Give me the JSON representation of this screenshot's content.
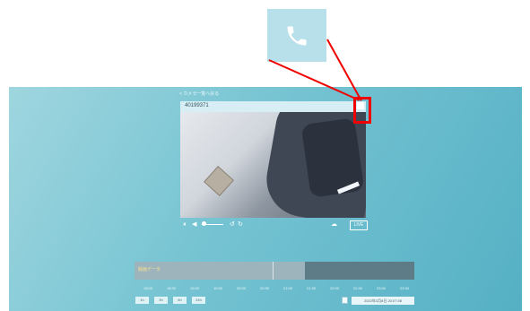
{
  "header": {
    "back_label": "< カメラ一覧へ戻る",
    "camera_id": "40199371"
  },
  "icons": {
    "phone": "phone-icon",
    "phone_small": "phone-icon",
    "back": "back-arrow-icon",
    "pause": "pause-icon",
    "prev": "prev-icon",
    "rotate": "rotate-icon",
    "cloud": "cloud-icon",
    "calendar": "calendar-icon"
  },
  "controls": {
    "pause": "⏸",
    "prev": "◀",
    "rotate_left": "↺",
    "rotate_right": "↻",
    "cloud": "☁",
    "rec": "LIVE"
  },
  "timeline": {
    "label": "録画データ",
    "ticks": [
      "18:00",
      "18:30",
      "19:00",
      "19:30",
      "20:00",
      "20:30",
      "21:00",
      "21:30",
      "22:00",
      "22:30",
      "23:00",
      "23:30"
    ]
  },
  "zoom_buttons": [
    "1h",
    "3h",
    "6h",
    "24h"
  ],
  "datetime": "2022年3月8日 20:07:08",
  "colors": {
    "highlight": "#f00000",
    "background": "#75c3d2",
    "zoom_bg": "#b7e0ea"
  }
}
